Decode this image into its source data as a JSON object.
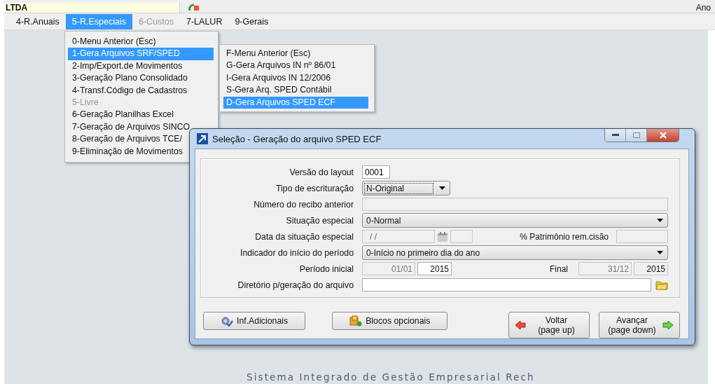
{
  "top_bar": {
    "company": "LTDA",
    "right_text": "Ano"
  },
  "menu_bar": [
    {
      "label": "4-R.Anuais",
      "selected": false,
      "disabled": false
    },
    {
      "label": "5-R.Especiais",
      "selected": true,
      "disabled": false
    },
    {
      "label": "6-Custos",
      "selected": false,
      "disabled": true
    },
    {
      "label": "7-LALUR",
      "selected": false,
      "disabled": false
    },
    {
      "label": "9-Gerais",
      "selected": false,
      "disabled": false
    }
  ],
  "menu": {
    "items": [
      {
        "label": "0-Menu Anterior (Esc)",
        "selected": false,
        "disabled": false
      },
      {
        "label": "1-Gera Arquivos SRF/SPED",
        "selected": true,
        "disabled": false
      },
      {
        "label": "2-Imp/Export.de Movimentos",
        "selected": false,
        "disabled": false
      },
      {
        "label": "3-Geração Plano Consolidado",
        "selected": false,
        "disabled": false
      },
      {
        "label": "4-Transf.Código de Cadastros",
        "selected": false,
        "disabled": false
      },
      {
        "label": "5-Livre",
        "selected": false,
        "disabled": true
      },
      {
        "label": "6-Geração Planilhas Excel",
        "selected": false,
        "disabled": false
      },
      {
        "label": "7-Geração de Arquivos SINCO",
        "selected": false,
        "disabled": false
      },
      {
        "label": "8-Geração de Arquivos TCE/",
        "selected": false,
        "disabled": false
      },
      {
        "label": "9-Eliminação de Movimentos",
        "selected": false,
        "disabled": false
      }
    ]
  },
  "submenu": {
    "items": [
      {
        "label": "F-Menu Anterior (Esc)",
        "selected": false
      },
      {
        "label": "G-Gera Arquivos IN nº 86/01",
        "selected": false
      },
      {
        "label": "I-Gera Arquivos IN 12/2006",
        "selected": false
      },
      {
        "label": "S-Gera Arq. SPED Contábil",
        "selected": false
      },
      {
        "label": "D-Gera Arquivos SPED ECF",
        "selected": true
      }
    ]
  },
  "dialog": {
    "title": "Seleção - Geração do arquivo SPED ECF",
    "fields": [
      {
        "label": "Versão do layout",
        "kind": "short-text",
        "value": "0001",
        "disabled": false
      },
      {
        "label": "Tipo de escrituração",
        "kind": "short-combo",
        "value": "N-Original"
      },
      {
        "label": "Número do recibo anterior",
        "kind": "text",
        "disabled": true
      },
      {
        "label": "Situação especial",
        "kind": "combo",
        "value": "0-Normal"
      },
      {
        "label": "Data da situação especial",
        "kind": "date",
        "value": "/ /",
        "extra_label": "% Patrimônio rem.cisão"
      },
      {
        "label": "Indicador do início do período",
        "kind": "combo",
        "value": "0-Início no primeiro dia do ano"
      },
      {
        "label": "Período inicial",
        "kind": "period",
        "start_day": "01/01",
        "start_year": "2015",
        "end_label": "Final",
        "end_day": "31/12",
        "end_year": "2015"
      },
      {
        "label": "Diretório p/geração do arquivo",
        "kind": "folder"
      }
    ],
    "buttons": [
      {
        "label": "Inf.Adicionais",
        "kind": "info"
      },
      {
        "label": "Blocos opcionais",
        "kind": "blocks"
      },
      {
        "label": "Voltar",
        "sublabel": "(page up)",
        "kind": "back"
      },
      {
        "label": "Avançar",
        "sublabel": "(page down)",
        "kind": "next"
      }
    ]
  },
  "logo": {
    "tagline": "Sistema Integrado de Gestão Empresarial Rech"
  }
}
